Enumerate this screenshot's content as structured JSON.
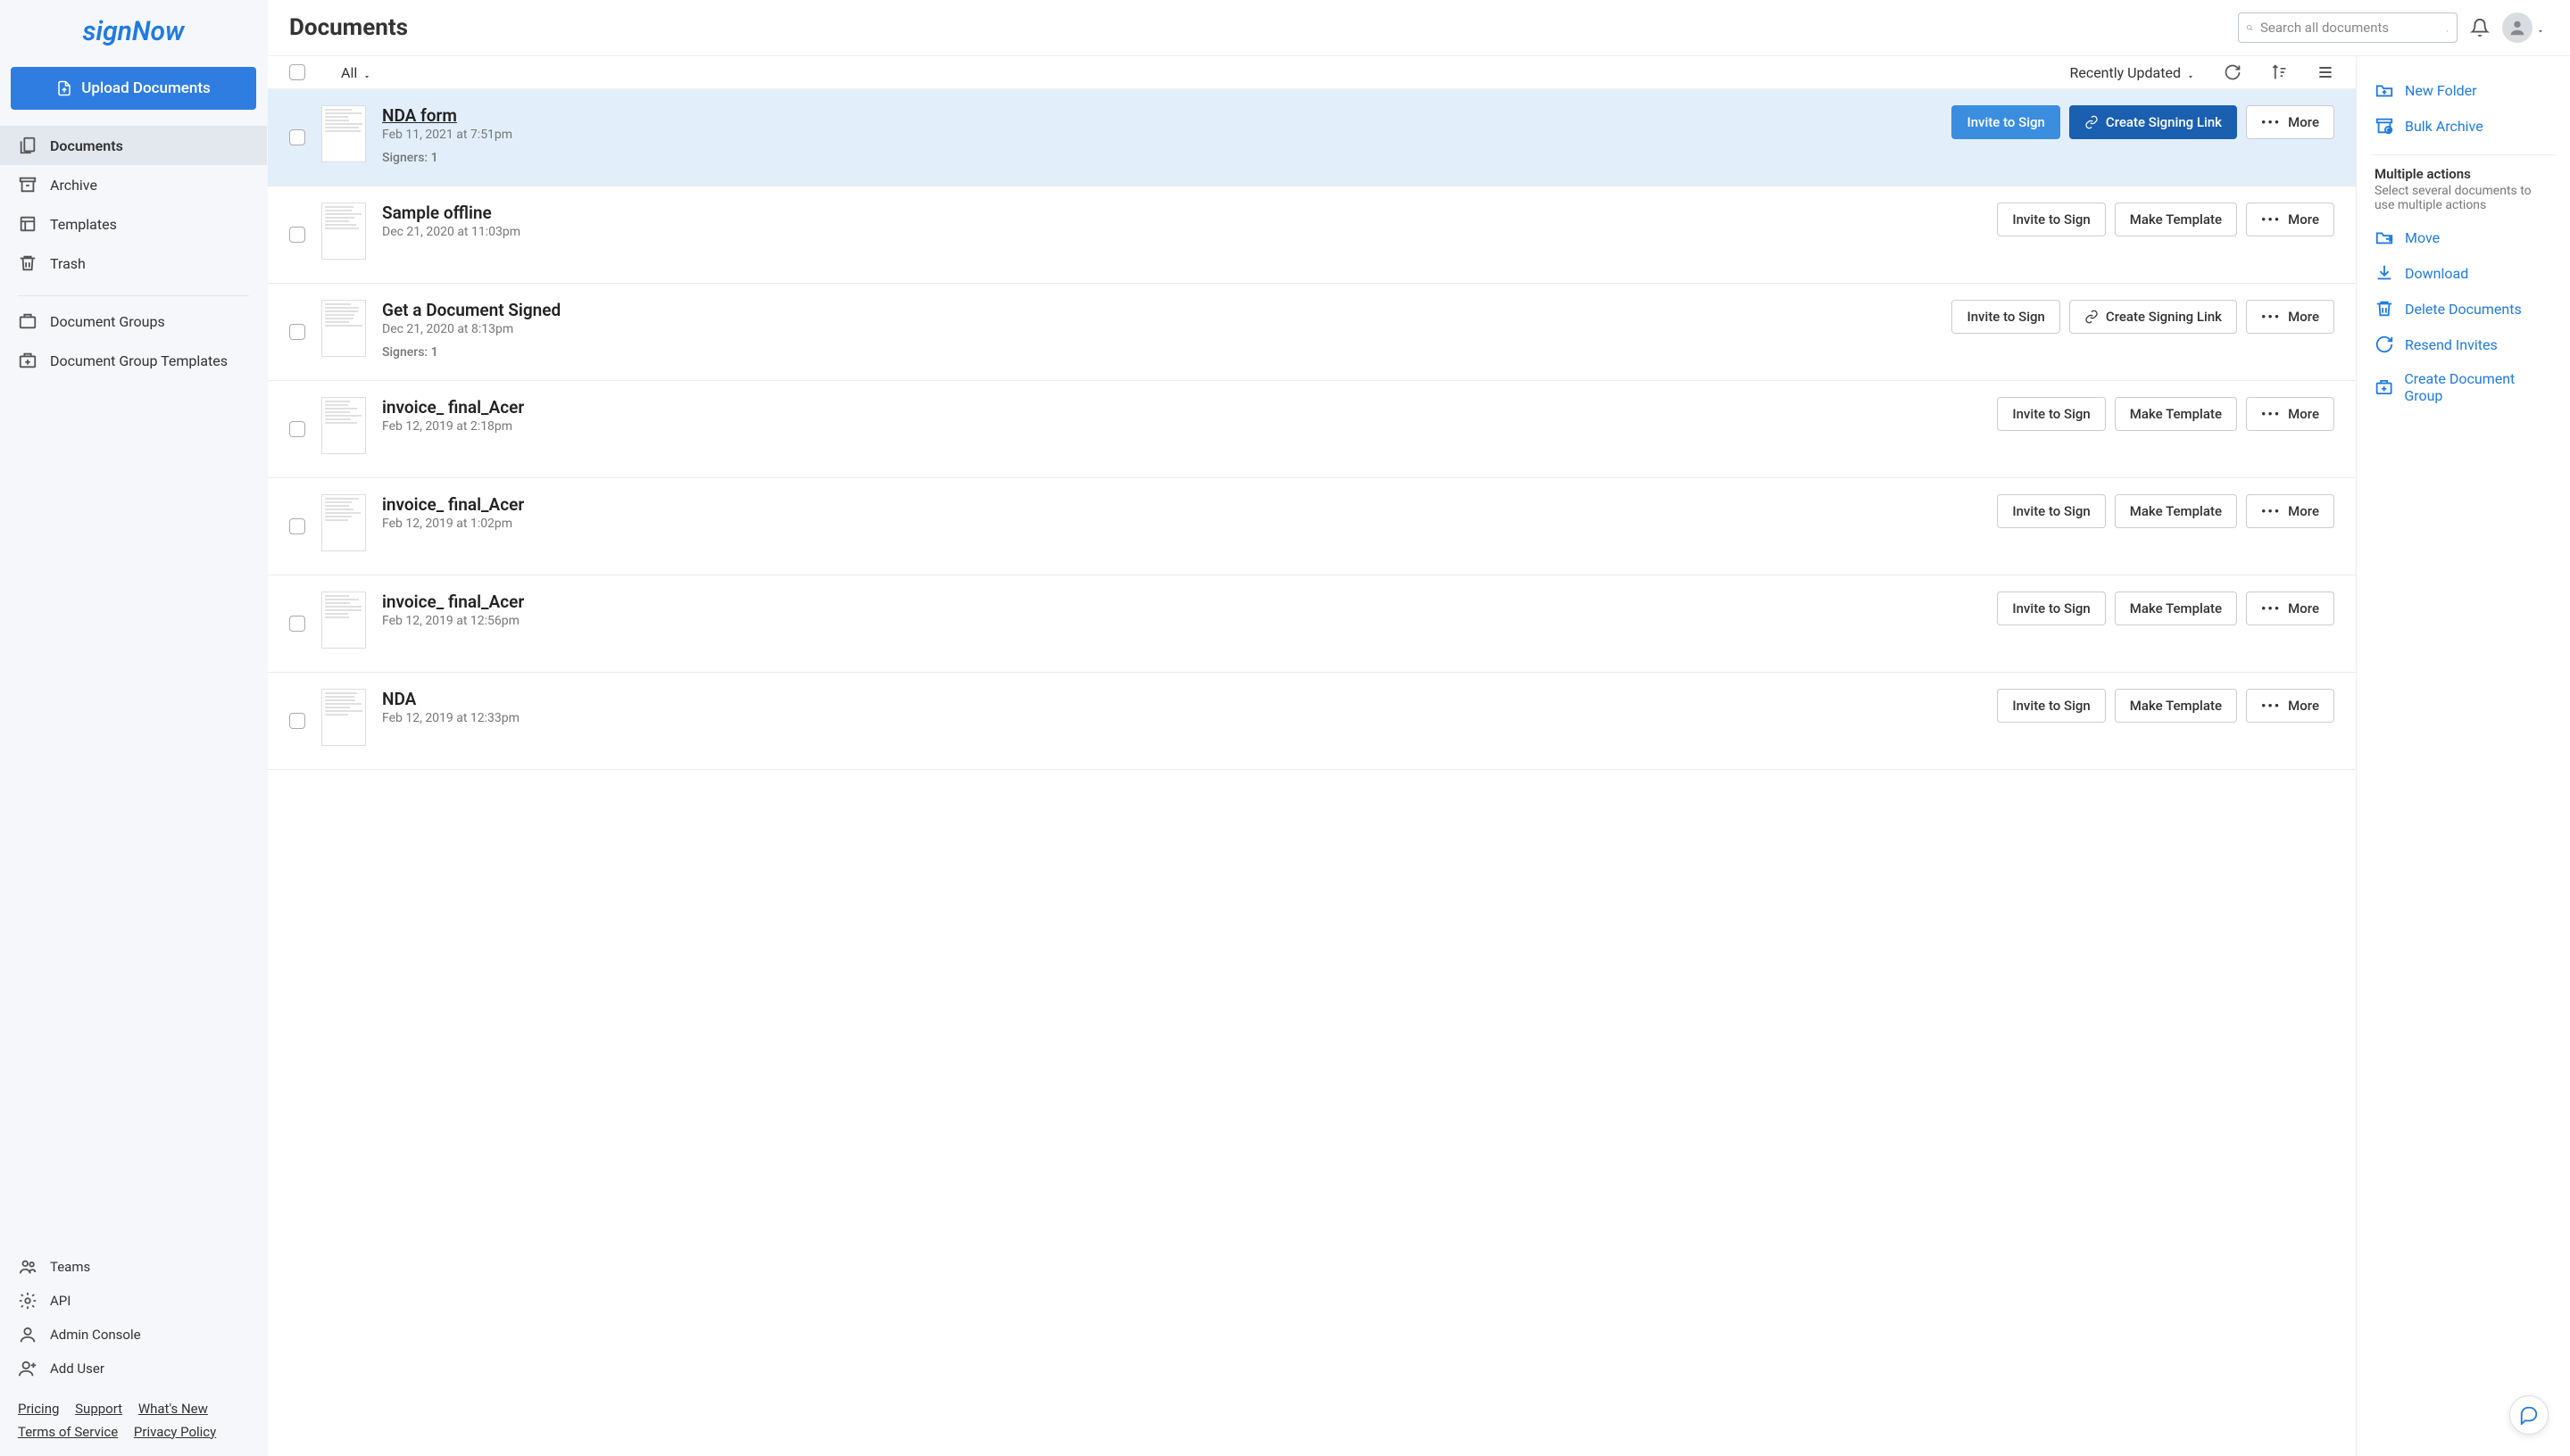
{
  "brand": "signNow",
  "upload_button": "Upload Documents",
  "nav": {
    "main": [
      {
        "label": "Documents",
        "icon": "documents",
        "selected": true
      },
      {
        "label": "Archive",
        "icon": "archive",
        "selected": false
      },
      {
        "label": "Templates",
        "icon": "templates",
        "selected": false
      },
      {
        "label": "Trash",
        "icon": "trash",
        "selected": false
      }
    ],
    "secondary": [
      {
        "label": "Document Groups",
        "icon": "doc-groups"
      },
      {
        "label": "Document Group Templates",
        "icon": "doc-group-templates"
      }
    ],
    "bottom": [
      {
        "label": "Teams",
        "icon": "teams"
      },
      {
        "label": "API",
        "icon": "api"
      },
      {
        "label": "Admin Console",
        "icon": "admin"
      },
      {
        "label": "Add User",
        "icon": "add-user"
      }
    ]
  },
  "footer_links": [
    "Pricing",
    "Support",
    "What's New",
    "Terms of Service",
    "Privacy Policy"
  ],
  "header": {
    "title": "Documents",
    "search_placeholder": "Search all documents"
  },
  "list_controls": {
    "filter_label": "All",
    "sort_label": "Recently Updated"
  },
  "action_labels": {
    "invite": "Invite to Sign",
    "make_template": "Make Template",
    "create_link": "Create Signing Link",
    "more": "More"
  },
  "documents": [
    {
      "title": "NDA form",
      "date": "Feb 11, 2021 at 7:51pm",
      "signers": "Signers: 1",
      "selected": true,
      "actions": [
        "invite_primary",
        "create_link_primary",
        "more"
      ]
    },
    {
      "title": "Sample offline",
      "date": "Dec 21, 2020 at 11:03pm",
      "signers": null,
      "selected": false,
      "actions": [
        "invite",
        "make_template",
        "more"
      ]
    },
    {
      "title": "Get a Document Signed",
      "date": "Dec 21, 2020 at 8:13pm",
      "signers": "Signers: 1",
      "selected": false,
      "actions": [
        "invite",
        "create_link",
        "more"
      ]
    },
    {
      "title": "invoice_ final_Acer",
      "date": "Feb 12, 2019 at 2:18pm",
      "signers": null,
      "selected": false,
      "actions": [
        "invite",
        "make_template",
        "more"
      ]
    },
    {
      "title": "invoice_ final_Acer",
      "date": "Feb 12, 2019 at 1:02pm",
      "signers": null,
      "selected": false,
      "actions": [
        "invite",
        "make_template",
        "more"
      ]
    },
    {
      "title": "invoice_ final_Acer",
      "date": "Feb 12, 2019 at 12:56pm",
      "signers": null,
      "selected": false,
      "actions": [
        "invite",
        "make_template",
        "more"
      ]
    },
    {
      "title": "NDA",
      "date": "Feb 12, 2019 at 12:33pm",
      "signers": null,
      "selected": false,
      "actions": [
        "invite",
        "make_template",
        "more"
      ]
    }
  ],
  "right_panel": {
    "primary_actions": [
      {
        "label": "New Folder",
        "icon": "new-folder"
      },
      {
        "label": "Bulk Archive",
        "icon": "bulk-archive"
      }
    ],
    "multi_title": "Multiple actions",
    "multi_desc": "Select several documents to use multiple actions",
    "multi_actions": [
      {
        "label": "Move",
        "icon": "move"
      },
      {
        "label": "Download",
        "icon": "download"
      },
      {
        "label": "Delete Documents",
        "icon": "delete"
      },
      {
        "label": "Resend Invites",
        "icon": "resend"
      },
      {
        "label": "Create Document Group",
        "icon": "create-group"
      }
    ]
  }
}
